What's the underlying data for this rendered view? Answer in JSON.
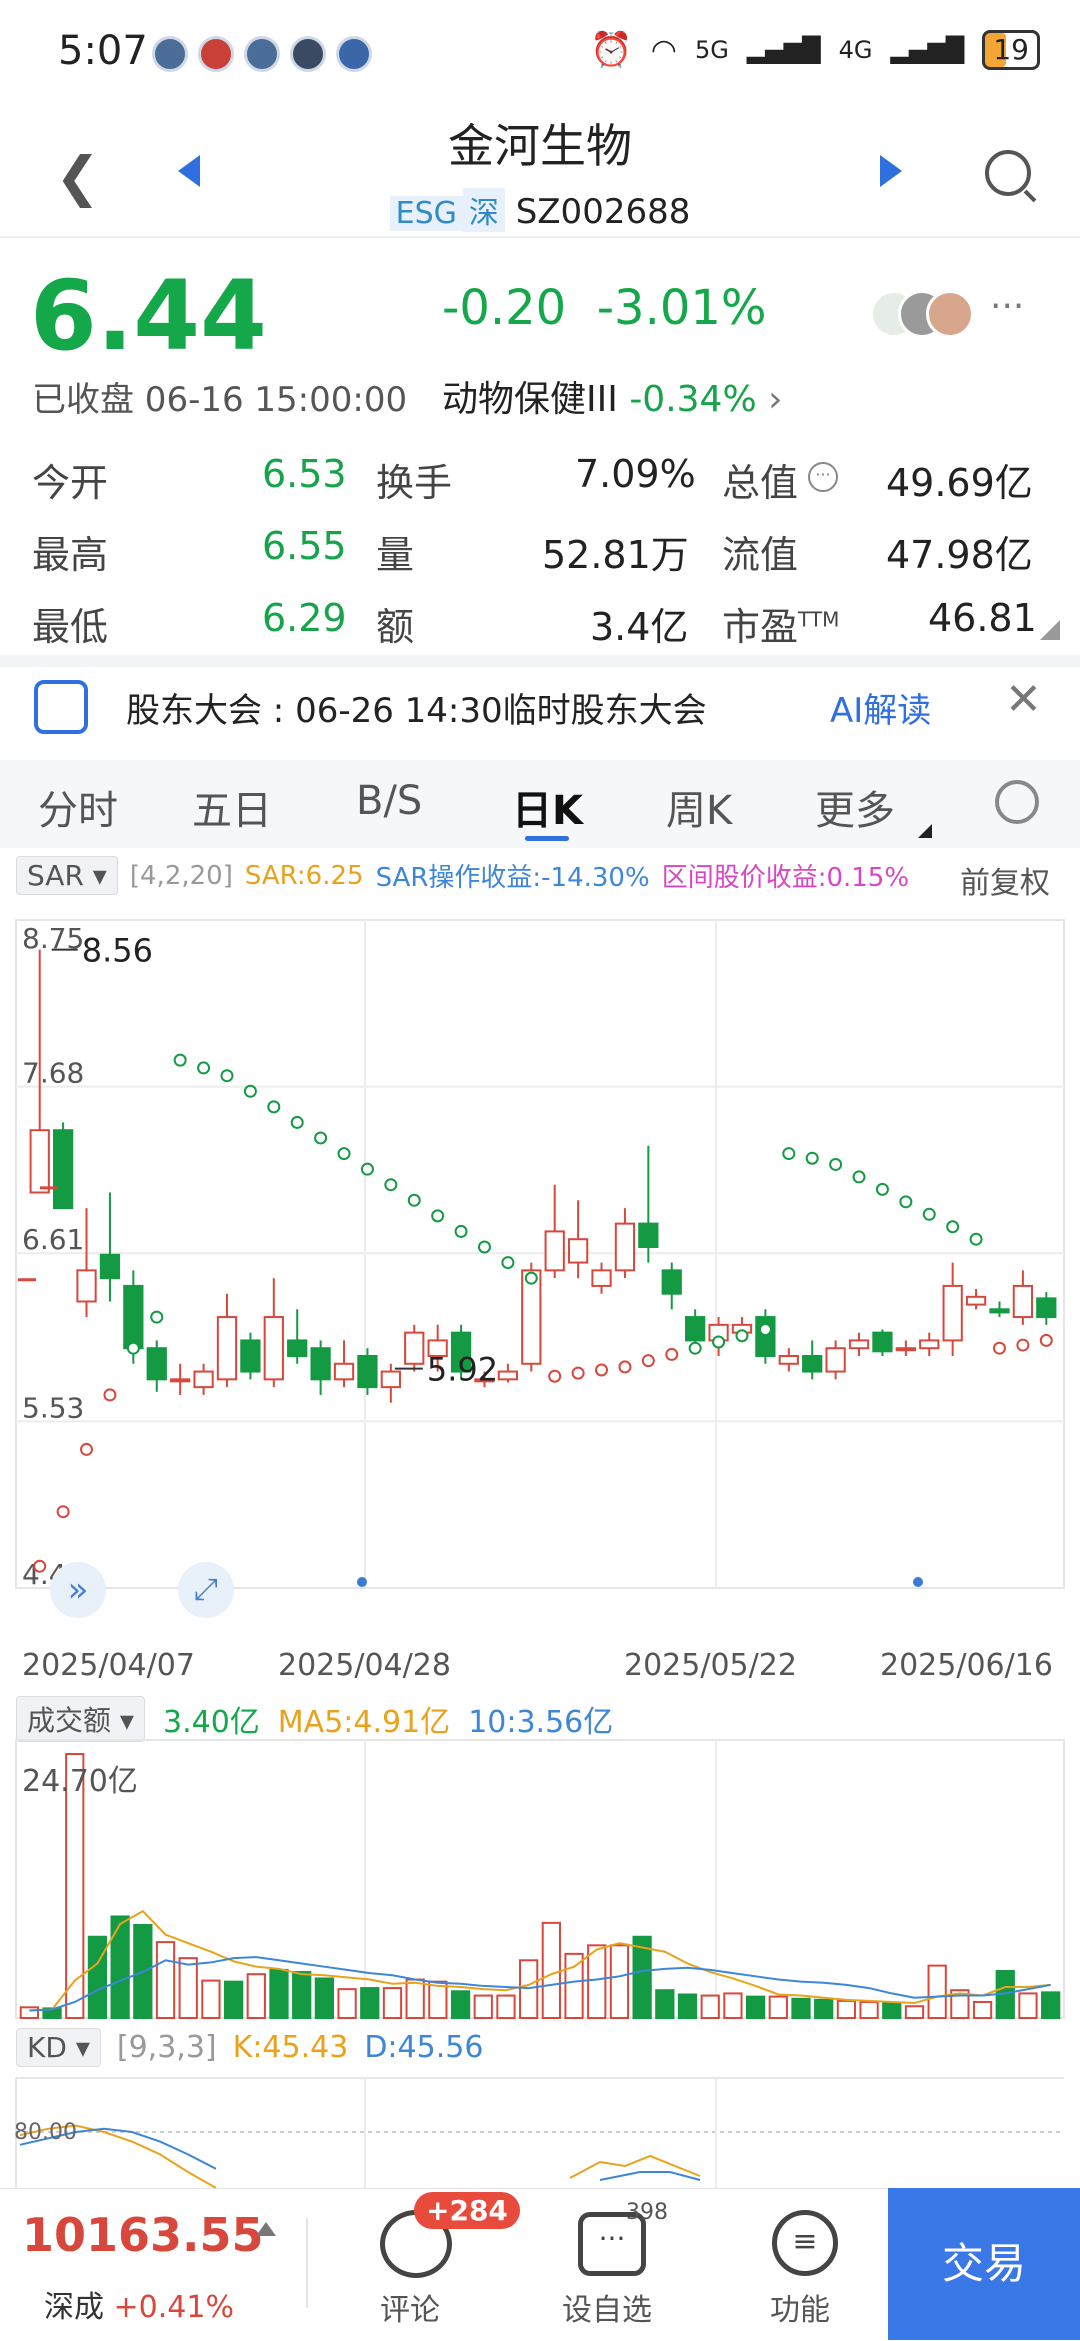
{
  "status_bar": {
    "time": "5:07",
    "signal1": "5G",
    "signal2": "4G",
    "battery": "19"
  },
  "header": {
    "title": "金河生物",
    "tag_esg": "ESG",
    "tag_market": "深",
    "code": "SZ002688"
  },
  "quote": {
    "price": "6.44",
    "change": "-0.20",
    "change_pct": "-3.01%",
    "closed_label": "已收盘 06-16 15:00:00",
    "sector_name": "动物保健III",
    "sector_pct": "-0.34%"
  },
  "stats": [
    {
      "l1": "今开",
      "v1": "6.53",
      "l2": "换手",
      "v2": "7.09%",
      "l3": "总值",
      "v3": "49.69亿"
    },
    {
      "l1": "最高",
      "v1": "6.55",
      "l2": "量",
      "v2": "52.81万",
      "l3": "流值",
      "v3": "47.98亿"
    },
    {
      "l1": "最低",
      "v1": "6.29",
      "l2": "额",
      "v2": "3.4亿",
      "l3": "市盈",
      "l3_sup": "TTM",
      "v3": "46.81"
    }
  ],
  "announcement": {
    "text": "股东大会 : 06-26 14:30临时股东大会",
    "ai": "AI解读"
  },
  "tabs": [
    "分时",
    "五日",
    "B/S",
    "日K",
    "周K",
    "更多"
  ],
  "active_tab": "日K",
  "sar_bar": {
    "name": "SAR",
    "params": "[4,2,20]",
    "sar": "SAR:6.25",
    "op": "SAR操作收益:-14.30%",
    "range": "区间股价收益:0.15%",
    "adjust": "前复权"
  },
  "volume_bar": {
    "name": "成交额",
    "v": "3.40亿",
    "ma5": "MA5:4.91亿",
    "ma10": "10:3.56亿",
    "max_label": "24.70亿"
  },
  "kd_bar": {
    "name": "KD",
    "params": "[9,3,3]",
    "k": "K:45.43",
    "d": "D:45.56",
    "level": "80.00"
  },
  "bottom": {
    "index_value": "10163.55",
    "index_name": "深成",
    "index_pct": "+0.41%",
    "comment_label": "评论",
    "comment_badge": "+284",
    "watch_label": "设自选",
    "watch_count": "398",
    "func_label": "功能",
    "trade_label": "交易"
  },
  "chart_data": {
    "type": "candlestick",
    "y_ticks": [
      "8.75",
      "7.68",
      "6.61",
      "5.53",
      "4.46"
    ],
    "x_labels": [
      "2025/04/07",
      "2025/04/28",
      "2025/05/22",
      "2025/06/16"
    ],
    "ylim": [
      4.46,
      8.75
    ],
    "high_label": "8.56",
    "low_label": "5.92",
    "candles": [
      [
        7.0,
        7.4,
        8.56,
        7.0
      ],
      [
        7.4,
        6.9,
        7.45,
        6.9
      ],
      [
        6.3,
        6.5,
        6.9,
        6.2
      ],
      [
        6.6,
        6.45,
        7.0,
        6.3
      ],
      [
        6.4,
        6.0,
        6.5,
        5.9
      ],
      [
        6.0,
        5.8,
        6.05,
        5.72
      ],
      [
        5.8,
        5.8,
        5.9,
        5.7
      ],
      [
        5.75,
        5.85,
        5.9,
        5.7
      ],
      [
        5.8,
        6.2,
        6.35,
        5.75
      ],
      [
        6.05,
        5.85,
        6.1,
        5.8
      ],
      [
        5.8,
        6.2,
        6.45,
        5.75
      ],
      [
        6.05,
        5.95,
        6.25,
        5.9
      ],
      [
        6.0,
        5.8,
        6.05,
        5.7
      ],
      [
        5.8,
        5.9,
        6.05,
        5.75
      ],
      [
        5.95,
        5.75,
        6.0,
        5.7
      ],
      [
        5.75,
        5.85,
        5.9,
        5.65
      ],
      [
        5.9,
        6.1,
        6.15,
        5.85
      ],
      [
        5.95,
        6.05,
        6.15,
        5.85
      ],
      [
        6.1,
        5.85,
        6.15,
        5.8
      ],
      [
        5.8,
        5.8,
        5.85,
        5.75
      ],
      [
        5.8,
        5.85,
        5.9,
        5.78
      ],
      [
        5.9,
        6.5,
        6.55,
        5.85
      ],
      [
        6.5,
        6.75,
        7.05,
        6.45
      ],
      [
        6.55,
        6.7,
        6.95,
        6.45
      ],
      [
        6.4,
        6.5,
        6.55,
        6.35
      ],
      [
        6.5,
        6.8,
        6.9,
        6.45
      ],
      [
        6.8,
        6.65,
        7.3,
        6.55
      ],
      [
        6.5,
        6.35,
        6.55,
        6.25
      ],
      [
        6.2,
        6.05,
        6.25,
        6.0
      ],
      [
        6.05,
        6.15,
        6.2,
        5.95
      ],
      [
        6.1,
        6.15,
        6.2,
        6.05
      ],
      [
        6.2,
        5.95,
        6.25,
        5.9
      ],
      [
        5.9,
        5.95,
        6.0,
        5.85
      ],
      [
        5.95,
        5.85,
        6.05,
        5.8
      ],
      [
        5.85,
        6.0,
        6.05,
        5.8
      ],
      [
        6.0,
        6.05,
        6.1,
        5.95
      ],
      [
        6.1,
        5.98,
        6.12,
        5.95
      ],
      [
        6.0,
        6.0,
        6.05,
        5.95
      ],
      [
        6.0,
        6.05,
        6.1,
        5.95
      ],
      [
        6.05,
        6.4,
        6.55,
        5.95
      ],
      [
        6.28,
        6.33,
        6.38,
        6.25
      ],
      [
        6.25,
        6.23,
        6.3,
        6.2
      ],
      [
        6.2,
        6.4,
        6.5,
        6.15
      ],
      [
        6.32,
        6.2,
        6.36,
        6.15
      ]
    ],
    "sar_points": [
      [
        0,
        4.6
      ],
      [
        1,
        4.95
      ],
      [
        2,
        5.35
      ],
      [
        3,
        5.7
      ],
      [
        4,
        6.0
      ],
      [
        5,
        6.2
      ],
      [
        6,
        7.85
      ],
      [
        7,
        7.8
      ],
      [
        8,
        7.75
      ],
      [
        9,
        7.65
      ],
      [
        10,
        7.55
      ],
      [
        11,
        7.45
      ],
      [
        12,
        7.35
      ],
      [
        13,
        7.25
      ],
      [
        14,
        7.15
      ],
      [
        15,
        7.05
      ],
      [
        16,
        6.95
      ],
      [
        17,
        6.85
      ],
      [
        18,
        6.75
      ],
      [
        19,
        6.65
      ],
      [
        20,
        6.55
      ],
      [
        21,
        6.45
      ],
      [
        22,
        5.82
      ],
      [
        23,
        5.84
      ],
      [
        24,
        5.86
      ],
      [
        25,
        5.88
      ],
      [
        26,
        5.92
      ],
      [
        27,
        5.96
      ],
      [
        28,
        6.0
      ],
      [
        29,
        6.04
      ],
      [
        30,
        6.08
      ],
      [
        31,
        6.12
      ],
      [
        32,
        7.25
      ],
      [
        33,
        7.22
      ],
      [
        34,
        7.18
      ],
      [
        35,
        7.1
      ],
      [
        36,
        7.02
      ],
      [
        37,
        6.94
      ],
      [
        38,
        6.86
      ],
      [
        39,
        6.78
      ],
      [
        40,
        6.7
      ],
      [
        41,
        6.0
      ],
      [
        42,
        6.02
      ],
      [
        43,
        6.05
      ]
    ],
    "volume": [
      1.0,
      0.9,
      24.7,
      7.6,
      9.5,
      8.7,
      7.1,
      5.6,
      3.5,
      3.4,
      4.1,
      4.5,
      4.3,
      3.7,
      2.7,
      2.8,
      2.8,
      3.6,
      3.4,
      2.5,
      2.1,
      2.1,
      5.4,
      8.9,
      6.0,
      6.8,
      6.8,
      7.6,
      2.6,
      2.2,
      2.1,
      2.3,
      2.0,
      2.0,
      1.8,
      1.7,
      1.6,
      1.5,
      1.4,
      1.1,
      4.9,
      2.6,
      1.5,
      4.4,
      2.3,
      2.4
    ],
    "volume_ma5": [
      0.7,
      0.8,
      3.5,
      5.1,
      8.8,
      10.0,
      7.8,
      7.0,
      6.2,
      5.3,
      4.8,
      4.6,
      4.1,
      4.0,
      3.8,
      3.6,
      3.2,
      3.3,
      3.0,
      2.9,
      2.7,
      2.6,
      3.1,
      4.1,
      4.8,
      6.4,
      7.0,
      6.6,
      6.2,
      5.1,
      4.3,
      3.7,
      3.0,
      2.2,
      2.1,
      1.9,
      1.7,
      1.6,
      1.5,
      1.4,
      2.0,
      2.3,
      2.1,
      2.9,
      2.9,
      3.1
    ],
    "volume_ma10": [
      0.7,
      0.8,
      1.5,
      2.6,
      3.5,
      4.3,
      5.4,
      5.0,
      5.2,
      5.6,
      5.7,
      5.4,
      5.1,
      4.8,
      4.5,
      4.2,
      4.0,
      3.6,
      3.3,
      3.2,
      3.0,
      2.9,
      2.8,
      3.1,
      3.4,
      3.6,
      3.9,
      4.4,
      4.6,
      4.7,
      4.5,
      4.2,
      3.9,
      3.6,
      3.4,
      3.3,
      3.1,
      2.8,
      2.3,
      1.9,
      2.0,
      2.1,
      2.1,
      2.3,
      2.7,
      3.1
    ],
    "kd_k": [
      78,
      82,
      84,
      80,
      74,
      66,
      55,
      45
    ],
    "kd_d": [
      72,
      76,
      80,
      82,
      80,
      74,
      66,
      57
    ]
  }
}
